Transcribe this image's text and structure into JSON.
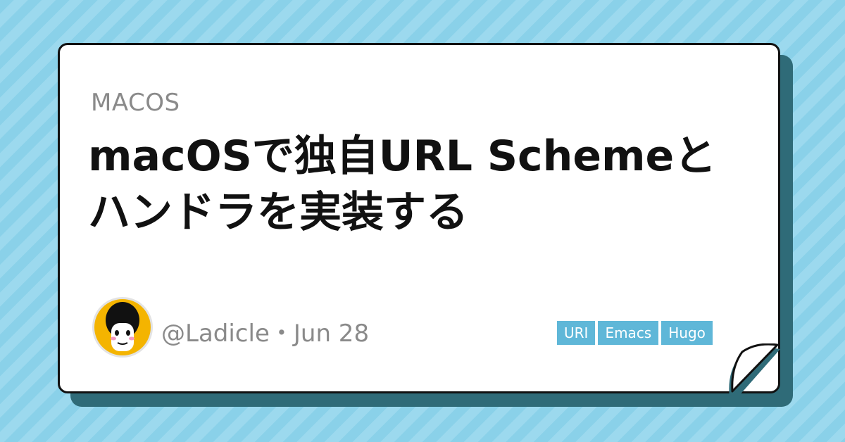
{
  "category": "MACOS",
  "title": "macOSで独自URL Schemeとハンドラを実装する",
  "author": {
    "handle": "@Ladicle",
    "separator": "・",
    "date": "Jun 28"
  },
  "tags": [
    "URI",
    "Emacs",
    "Hugo"
  ],
  "colors": {
    "background": "#8fd3ea",
    "card_shadow": "#2f6b78",
    "tag_bg": "#5fb7d8",
    "avatar_bg": "#f4b400"
  }
}
